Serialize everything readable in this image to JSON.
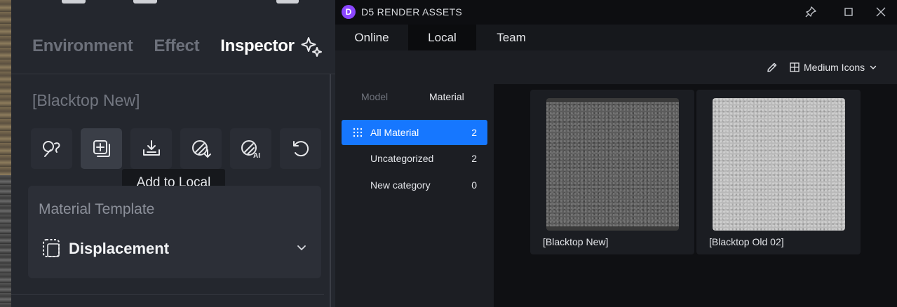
{
  "inspector": {
    "tabs": [
      "Environment",
      "Effect",
      "Inspector"
    ],
    "active_tab": "Inspector",
    "material_name": "[Blacktop New]",
    "tools": [
      {
        "icon": "material-picker-icon"
      },
      {
        "icon": "add-to-local-icon"
      },
      {
        "icon": "import-icon"
      },
      {
        "icon": "material-download-icon"
      },
      {
        "icon": "ai-material-icon"
      },
      {
        "icon": "reset-icon"
      }
    ],
    "tooltip": "Add to Local",
    "template": {
      "title": "Material Template",
      "value": "Displacement"
    }
  },
  "assets_window": {
    "title": "D5 RENDER ASSETS",
    "logo_letter": "D",
    "accent_color": "#1677ff",
    "logo_color": "#8b46ff",
    "tabs": [
      "Online",
      "Local",
      "Team"
    ],
    "active_tab": "Local",
    "view_mode": "Medium Icons",
    "sub_tabs": [
      "Model",
      "Material"
    ],
    "active_sub_tab": "Material",
    "categories": [
      {
        "label": "All Material",
        "count": "2"
      },
      {
        "label": "Uncategorized",
        "count": "2"
      },
      {
        "label": "New category",
        "count": "0"
      }
    ],
    "items": [
      {
        "name": "[Blacktop New]"
      },
      {
        "name": "[Blacktop Old 02]"
      }
    ]
  }
}
